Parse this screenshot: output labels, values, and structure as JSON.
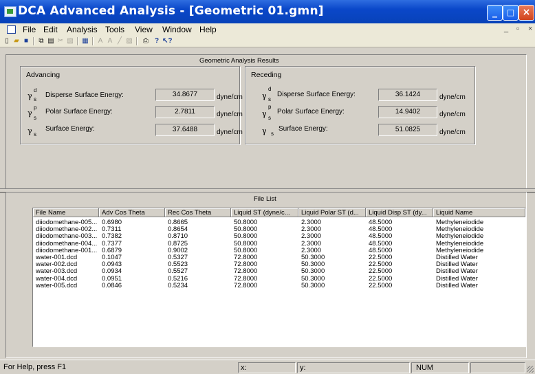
{
  "window": {
    "title": "DCA Advanced Analysis - [Geometric 01.gmn]",
    "controls": {
      "minimize": "_",
      "maximize": "□",
      "close": "×"
    }
  },
  "menu": {
    "items": [
      "File",
      "Edit",
      "Analysis",
      "Tools",
      "View",
      "Window",
      "Help"
    ],
    "mdi_controls": [
      "_",
      "▫",
      "×"
    ]
  },
  "toolbar": {
    "buttons": [
      "new-icon",
      "open-icon",
      "save-icon",
      "copy-icon",
      "paste-icon",
      "cut-icon",
      "image-icon",
      "grid-icon",
      "text-a-icon",
      "text-a2-icon",
      "line-icon",
      "fill-icon",
      "print-icon",
      "help-icon",
      "context-help-icon"
    ]
  },
  "results": {
    "caption": "Geometric Analysis Results",
    "advancing": {
      "label": "Advancing",
      "rows": [
        {
          "symbol": "γ",
          "sup": "d",
          "sub": "s",
          "label": "Disperse Surface Energy:",
          "value": "34.8677",
          "unit": "dyne/cm"
        },
        {
          "symbol": "γ",
          "sup": "p",
          "sub": "s",
          "label": "Polar Surface Energy:",
          "value": "2.7811",
          "unit": "dyne/cm"
        },
        {
          "symbol": "γ",
          "sup": "",
          "sub": "s",
          "label": "Surface Energy:",
          "value": "37.6488",
          "unit": "dyne/cm"
        }
      ]
    },
    "receding": {
      "label": "Receding",
      "rows": [
        {
          "symbol": "γ",
          "sup": "d",
          "sub": "s",
          "label": "Disperse Surface Energy:",
          "value": "36.1424",
          "unit": "dyne/cm"
        },
        {
          "symbol": "γ",
          "sup": "p",
          "sub": "s",
          "label": "Polar Surface Energy:",
          "value": "14.9402",
          "unit": "dyne/cm"
        },
        {
          "symbol": "γ",
          "sup": "",
          "sub": "s",
          "label": "Surface Energy:",
          "value": "51.0825",
          "unit": "dyne/cm"
        }
      ]
    }
  },
  "filelist": {
    "caption": "File List",
    "columns": [
      "File Name",
      "Adv Cos Theta",
      "Rec Cos Theta",
      "Liquid ST (dyne/c...",
      "Liquid Polar ST (d...",
      "Liquid Disp ST (dy...",
      "Liquid Name"
    ],
    "rows": [
      [
        "diiodomethane-005....",
        "0.6980",
        "0.8665",
        "50.8000",
        "2.3000",
        "48.5000",
        "Methyleneiodide"
      ],
      [
        "diiodomethane-002....",
        "0.7311",
        "0.8654",
        "50.8000",
        "2.3000",
        "48.5000",
        "Methyleneiodide"
      ],
      [
        "diiodomethane-003....",
        "0.7382",
        "0.8710",
        "50.8000",
        "2.3000",
        "48.5000",
        "Methyleneiodide"
      ],
      [
        "diiodomethane-004....",
        "0.7377",
        "0.8725",
        "50.8000",
        "2.3000",
        "48.5000",
        "Methyleneiodide"
      ],
      [
        "diiodomethane-001....",
        "0.6879",
        "0.9002",
        "50.8000",
        "2.3000",
        "48.5000",
        "Methyleneiodide"
      ],
      [
        "water-001.dcd",
        "0.1047",
        "0.5327",
        "72.8000",
        "50.3000",
        "22.5000",
        "Distilled Water"
      ],
      [
        "water-002.dcd",
        "0.0943",
        "0.5523",
        "72.8000",
        "50.3000",
        "22.5000",
        "Distilled Water"
      ],
      [
        "water-003.dcd",
        "0.0934",
        "0.5527",
        "72.8000",
        "50.3000",
        "22.5000",
        "Distilled Water"
      ],
      [
        "water-004.dcd",
        "0.0951",
        "0.5216",
        "72.8000",
        "50.3000",
        "22.5000",
        "Distilled Water"
      ],
      [
        "water-005.dcd",
        "0.0846",
        "0.5234",
        "72.8000",
        "50.3000",
        "22.5000",
        "Distilled Water"
      ]
    ]
  },
  "status": {
    "help": "For Help, press F1",
    "x_label": "x:",
    "y_label": "y:",
    "num": "NUM"
  },
  "colors": {
    "titlebar": "#0a47c9",
    "window_bg": "#d4d0c8",
    "menubar_bg": "#ece9d8"
  }
}
